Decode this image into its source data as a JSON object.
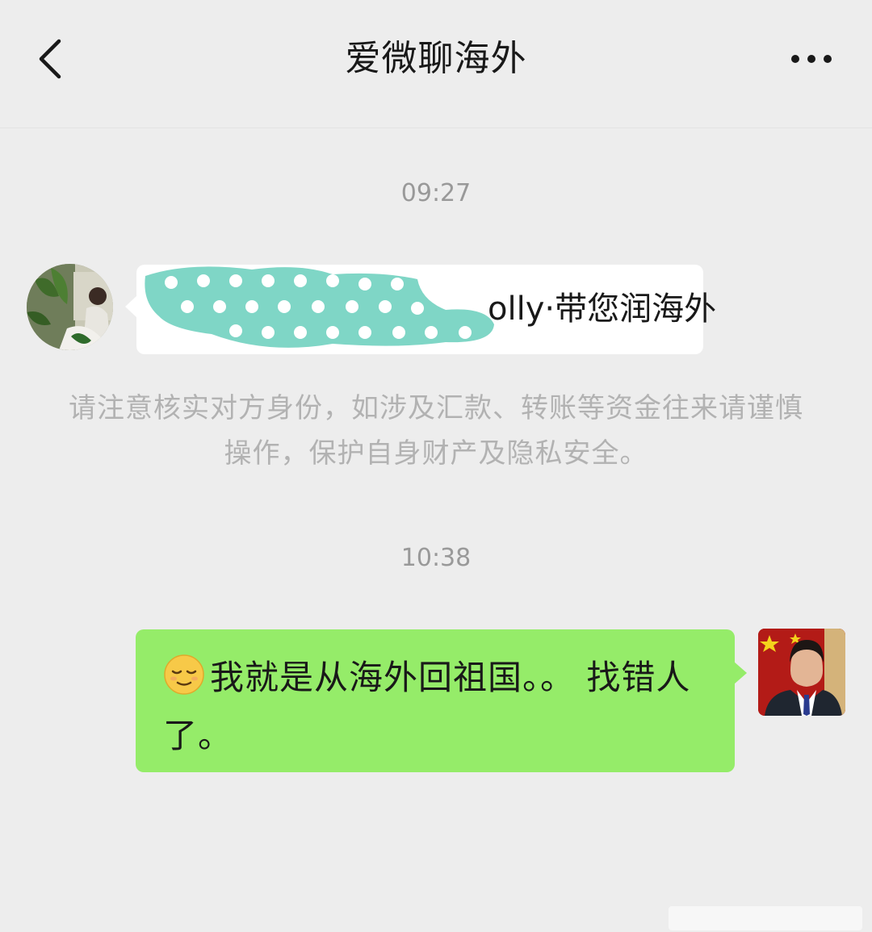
{
  "header": {
    "title": "爱微聊海外",
    "back_icon": "chevron-left-icon",
    "more_icon": "more-dots-icon"
  },
  "messages": [
    {
      "timestamp": "09:27",
      "direction": "incoming",
      "text_visible": "olly·带您润海外"
    },
    {
      "timestamp": "10:38",
      "direction": "outgoing",
      "emoji": "relieved-face-emoji",
      "text": "我就是从海外回祖国。。 找错人了。"
    }
  ],
  "notice": "请注意核实对方身份，如涉及汇款、转账等资金往来请谨慎操作，保护自身财产及隐私安全。",
  "colors": {
    "background": "#ededed",
    "incoming_bubble": "#ffffff",
    "outgoing_bubble": "#95ec69",
    "redaction": "#7fd6c6"
  }
}
